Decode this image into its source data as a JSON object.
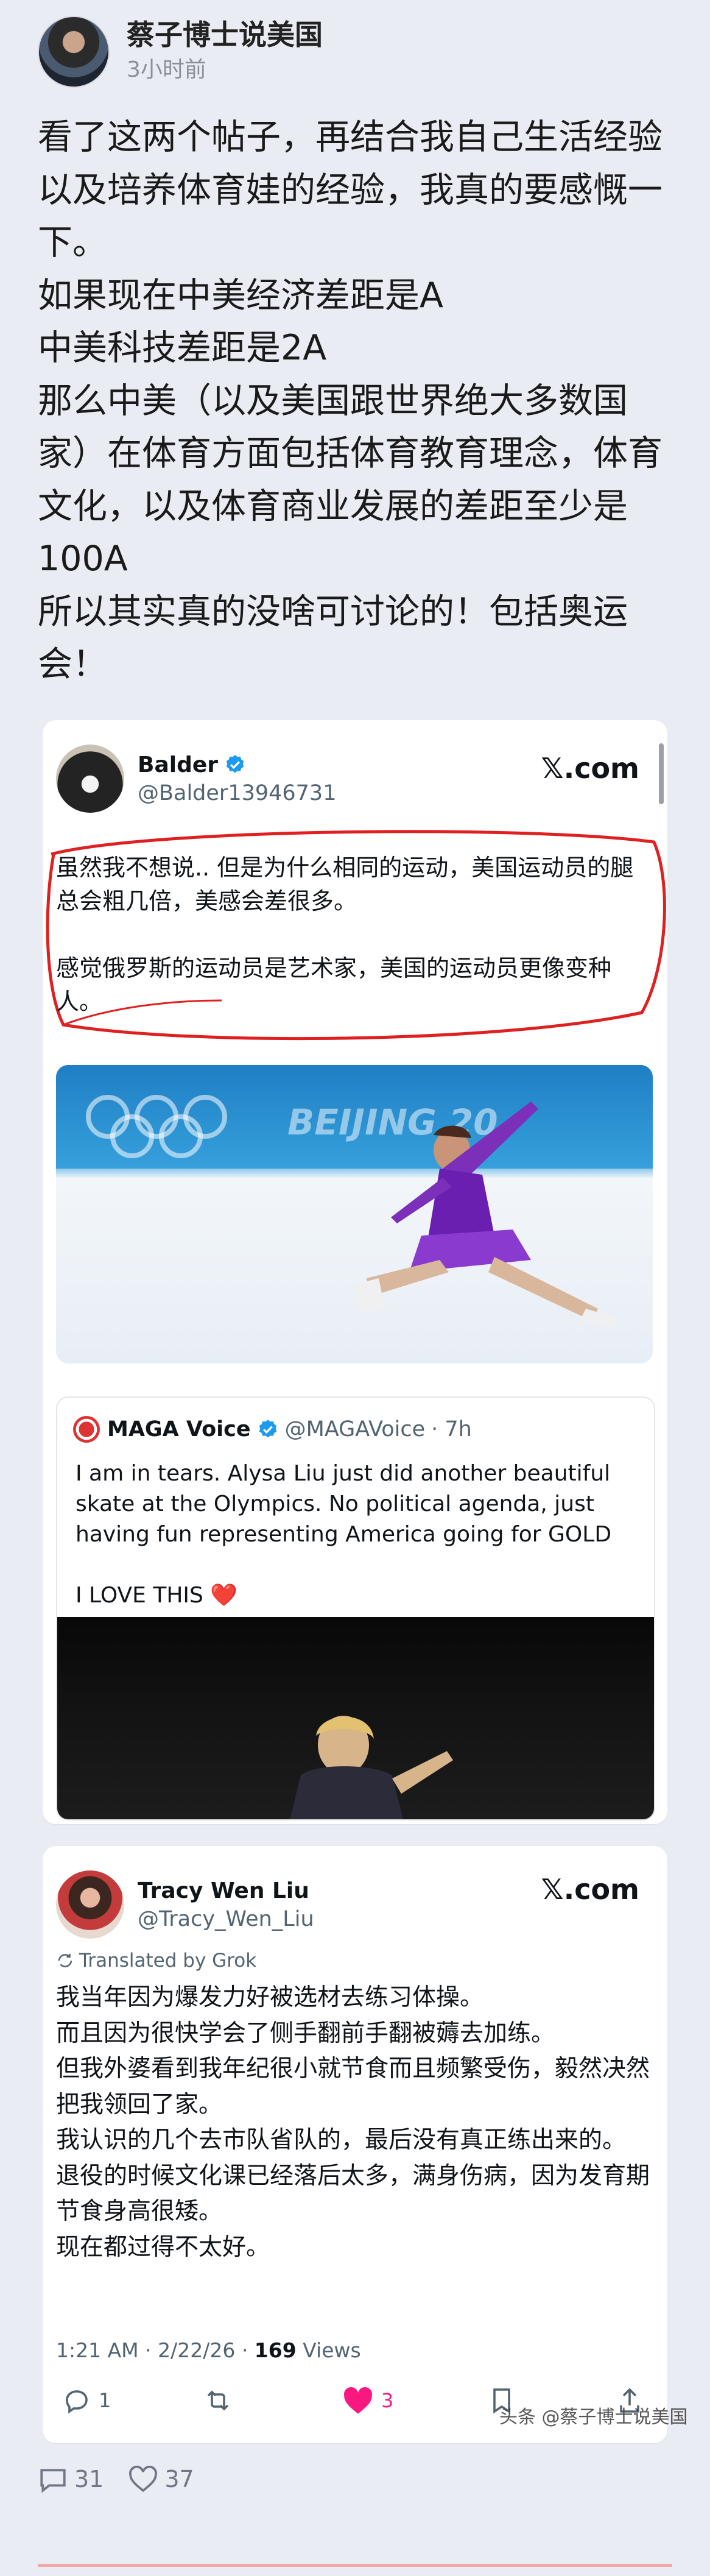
{
  "post": {
    "author": "蔡子博士说美国",
    "time": "3小时前",
    "paragraphs": [
      "看了这两个帖子，再结合我自己生活经验以及培养体育娃的经验，我真的要感慨一下。",
      "如果现在中美经济差距是A",
      "中美科技差距是2A",
      "那么中美（以及美国跟世界绝大多数国家）在体育方面包括体育教育理念，体育文化，以及体育商业发展的差距至少是100A",
      "所以其实真的没啥可讨论的！包括奥运会！"
    ]
  },
  "tweet1": {
    "name": "Balder",
    "handle": "@Balder13946731",
    "site": "𝕏.com",
    "paragraphs": [
      "虽然我不想说.. 但是为什么相同的运动，美国运动员的腿总会粗几倍，美感会差很多。",
      "感觉俄罗斯的运动员是艺术家，美国的运动员更像变种人。"
    ],
    "photo_banner_text": "BEIJING 20",
    "quote": {
      "name": "MAGA Voice",
      "handle": "@MAGAVoice",
      "time": "· 7h",
      "paragraphs": [
        "I am in tears. Alysa Liu just did another beautiful skate at the Olympics. No political agenda, just having fun representing America going for GOLD",
        "I LOVE THIS ❤️"
      ]
    }
  },
  "tweet2": {
    "name": "Tracy Wen Liu",
    "handle": "@Tracy_Wen_Liu",
    "site": "𝕏.com",
    "translated": "Translated by Grok",
    "paragraphs": [
      "我当年因为爆发力好被选材去练习体操。",
      "而且因为很快学会了侧手翻前手翻被薅去加练。",
      "但我外婆看到我年纪很小就节食而且频繁受伤，毅然决然把我领回了家。",
      "我认识的几个去市队省队的，最后没有真正练出来的。",
      "退役的时候文化课已经落后太多，满身伤病，因为发育期节食身高很矮。",
      "现在都过得不太好。"
    ],
    "footer_time": "1:21 AM · 2/22/26 · ",
    "views_count": "169",
    "views_label": " Views",
    "reply_count": "1",
    "like_count": "3"
  },
  "watermark": "头条 @蔡子博士说美国",
  "stats": {
    "comments": "31",
    "likes": "37"
  },
  "colors": {
    "background": "#e9ecf3",
    "x_blue": "#1d9bf0",
    "heart": "#f91880",
    "annotation_red": "#e02020"
  },
  "icons": [
    "verified-badge-icon",
    "translate-icon",
    "reply-icon",
    "retweet-icon",
    "heart-icon",
    "bookmark-icon",
    "share-icon",
    "comment-icon",
    "like-icon"
  ]
}
